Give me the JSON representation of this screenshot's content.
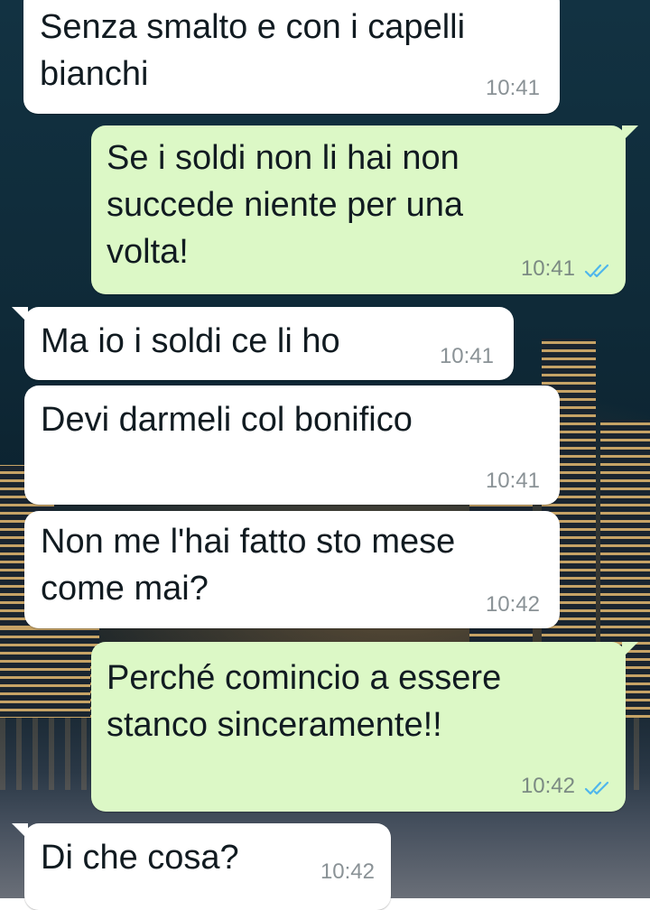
{
  "messages": [
    {
      "direction": "incoming",
      "text": "Senza smalto e con i capelli\nbianchi",
      "time": "10:41"
    },
    {
      "direction": "outgoing",
      "text": "Se i soldi non li hai non\nsuccede niente per una\nvolta!",
      "time": "10:41",
      "status": "read"
    },
    {
      "direction": "incoming",
      "text": "Ma io i soldi ce li ho",
      "time": "10:41"
    },
    {
      "direction": "incoming",
      "text": "Devi darmeli col bonifico",
      "time": "10:41"
    },
    {
      "direction": "incoming",
      "text": "Non me l'hai fatto sto mese\ncome mai?",
      "time": "10:42"
    },
    {
      "direction": "outgoing",
      "text": "Perché comincio a essere\nstanco sinceramente!!",
      "time": "10:42",
      "status": "read"
    },
    {
      "direction": "incoming",
      "text": "Di che cosa?",
      "time": "10:42"
    }
  ],
  "colors": {
    "incoming_bubble": "#ffffff",
    "outgoing_bubble": "#dcf8c6",
    "read_ticks": "#4fb6ec"
  },
  "icons": {
    "read_receipt": "double-check-icon"
  }
}
